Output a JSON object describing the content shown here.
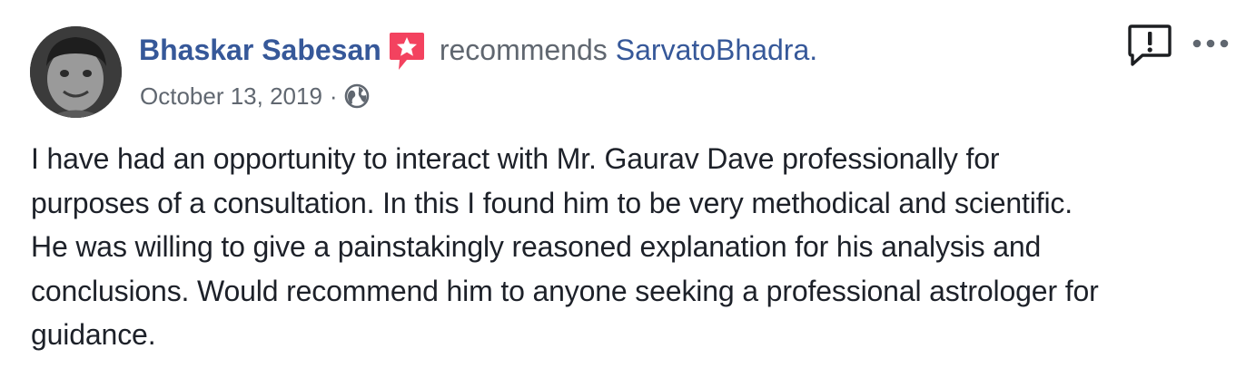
{
  "post": {
    "author_name": "Bhaskar Sabesan",
    "action_text": "recommends",
    "page_name": "SarvatoBhadra",
    "period": ".",
    "date": "October 13, 2019",
    "meta_separator": "·",
    "privacy_icon": "globe-icon",
    "recommendation_icon": "recommendation-star-icon",
    "report_icon": "report-flag-icon",
    "more_icon": "more-options-icon",
    "body_lines": [
      "I have had an opportunity to interact with Mr. Gaurav Dave professionally for",
      "purposes of a consultation. In this I found him to be very methodical and scientific.",
      "He was willing to give a painstakingly reasoned explanation for his analysis and",
      "conclusions. Would recommend him to anyone seeking a professional astrologer for",
      "guidance."
    ]
  },
  "colors": {
    "link_blue": "#365899",
    "meta_gray": "#606770",
    "body_text": "#1d2129",
    "recommend_red": "#f3425f"
  }
}
